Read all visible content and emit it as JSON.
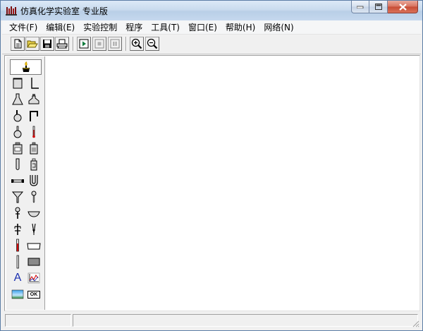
{
  "window": {
    "title": "仿真化学实验室 专业版",
    "accent_title_bar": "#c9dbee",
    "close_button_color": "#c74b34"
  },
  "caption_buttons": {
    "minimize": "minimize-icon",
    "maximize": "maximize-icon",
    "close": "close-icon"
  },
  "menu": {
    "items": [
      {
        "label": "文件(F)"
      },
      {
        "label": "编辑(E)"
      },
      {
        "label": "实验控制"
      },
      {
        "label": "程序"
      },
      {
        "label": "工具(T)"
      },
      {
        "label": "窗口(E)"
      },
      {
        "label": "帮助(H)"
      },
      {
        "label": "网络(N)"
      }
    ]
  },
  "toolbar": {
    "buttons": [
      {
        "icon": "new-file-icon"
      },
      {
        "icon": "open-folder-icon"
      },
      {
        "icon": "save-icon"
      },
      {
        "icon": "print-icon"
      },
      {
        "icon": "play-icon"
      },
      {
        "icon": "stop-icon"
      },
      {
        "icon": "pause-icon"
      },
      {
        "icon": "zoom-in-icon"
      },
      {
        "icon": "zoom-out-icon"
      }
    ]
  },
  "palette": {
    "selected_tool": "alcohol-lamp-icon",
    "tools": [
      "beaker-icon",
      "iron-stand-icon",
      "conical-flask-icon",
      "flask-with-stopper-icon",
      "round-bottom-flask-icon",
      "bent-glass-tube-icon",
      "round-flask-icon",
      "thermometer-icon",
      "reagent-bottle-icon",
      "labeled-bottle-icon",
      "test-tube-icon",
      "gas-bottle-icon",
      "straight-tube-icon",
      "u-tube-icon",
      "funnel-icon",
      "dropper-icon",
      "separatory-funnel-icon",
      "evaporating-dish-icon",
      "clamp-icon",
      "tongs-icon",
      "burette-icon",
      "trough-icon",
      "glass-rod-icon",
      "plate-icon",
      "text-tool-icon",
      "graph-tool-icon",
      "image-tool-icon",
      "ok-button-icon"
    ],
    "text_tool_glyph": "A",
    "ok_glyph": "OK"
  },
  "status": {
    "pane1": "",
    "pane2": ""
  }
}
